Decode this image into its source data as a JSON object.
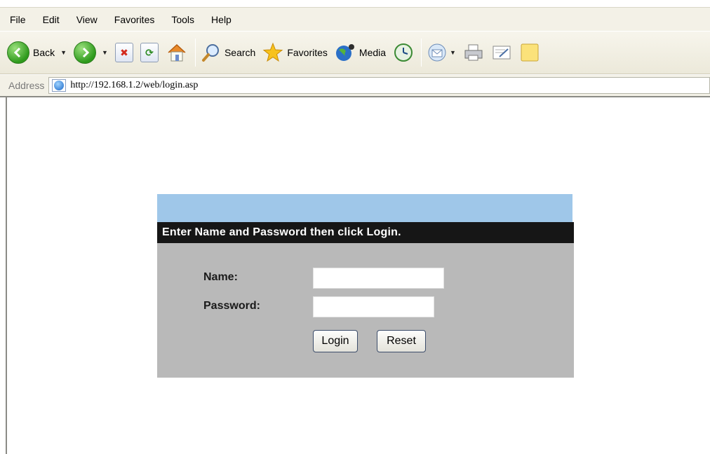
{
  "menubar": {
    "items": [
      "File",
      "Edit",
      "View",
      "Favorites",
      "Tools",
      "Help"
    ]
  },
  "toolbar": {
    "back_label": "Back",
    "search_label": "Search",
    "favorites_label": "Favorites",
    "media_label": "Media"
  },
  "addressbar": {
    "label": "Address",
    "url": "http://192.168.1.2/web/login.asp"
  },
  "login": {
    "instruction": "Enter Name and Password then click Login.",
    "name_label": "Name:",
    "password_label": "Password:",
    "name_value": "",
    "password_value": "",
    "login_button": "Login",
    "reset_button": "Reset"
  },
  "colors": {
    "panel_topband": "#9fc7e9",
    "panel_header_bg": "#161616",
    "panel_body_bg": "#b9b9b9"
  }
}
